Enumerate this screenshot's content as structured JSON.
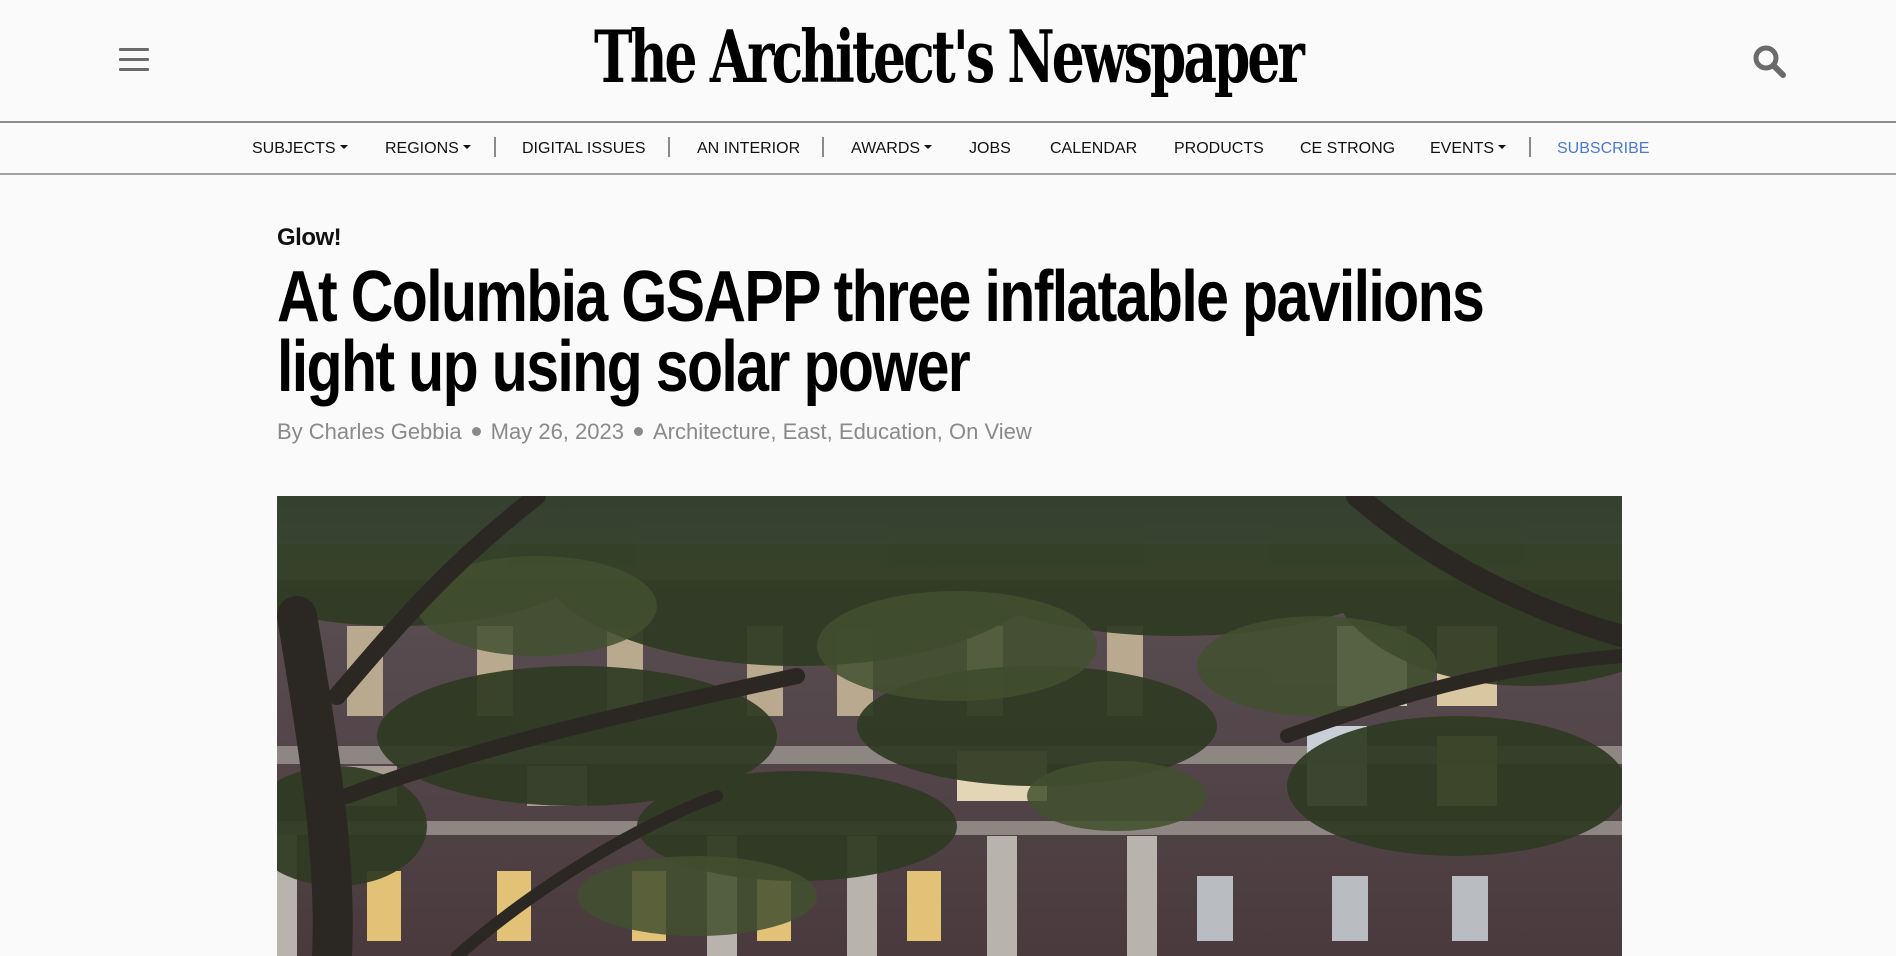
{
  "header": {
    "logo_text": "The Architect's Newspaper",
    "menu_icon": "hamburger-menu-icon",
    "search_icon": "search-icon"
  },
  "nav": {
    "items": [
      {
        "label": "SUBJECTS",
        "dropdown": true
      },
      {
        "label": "REGIONS",
        "dropdown": true
      },
      {
        "label": "DIGITAL ISSUES",
        "dropdown": false
      },
      {
        "label": "AN INTERIOR",
        "dropdown": false
      },
      {
        "label": "AWARDS",
        "dropdown": true
      },
      {
        "label": "JOBS",
        "dropdown": false
      },
      {
        "label": "CALENDAR",
        "dropdown": false
      },
      {
        "label": "PRODUCTS",
        "dropdown": false
      },
      {
        "label": "CE STRONG",
        "dropdown": false
      },
      {
        "label": "EVENTS",
        "dropdown": true
      },
      {
        "label": "SUBSCRIBE",
        "dropdown": false
      }
    ],
    "subscribe_color": "#4a78d8"
  },
  "article": {
    "kicker": "Glow!",
    "headline_line1": "At Columbia GSAPP three inflatable pavilions",
    "headline_line2": "light up using solar power",
    "author": "By Charles Gebbia",
    "date": "May 26, 2023",
    "categories": [
      "Architecture",
      "East",
      "Education",
      "On View"
    ],
    "category_separator": ","
  },
  "hero_image": {
    "description_icon": "hero-photo"
  }
}
